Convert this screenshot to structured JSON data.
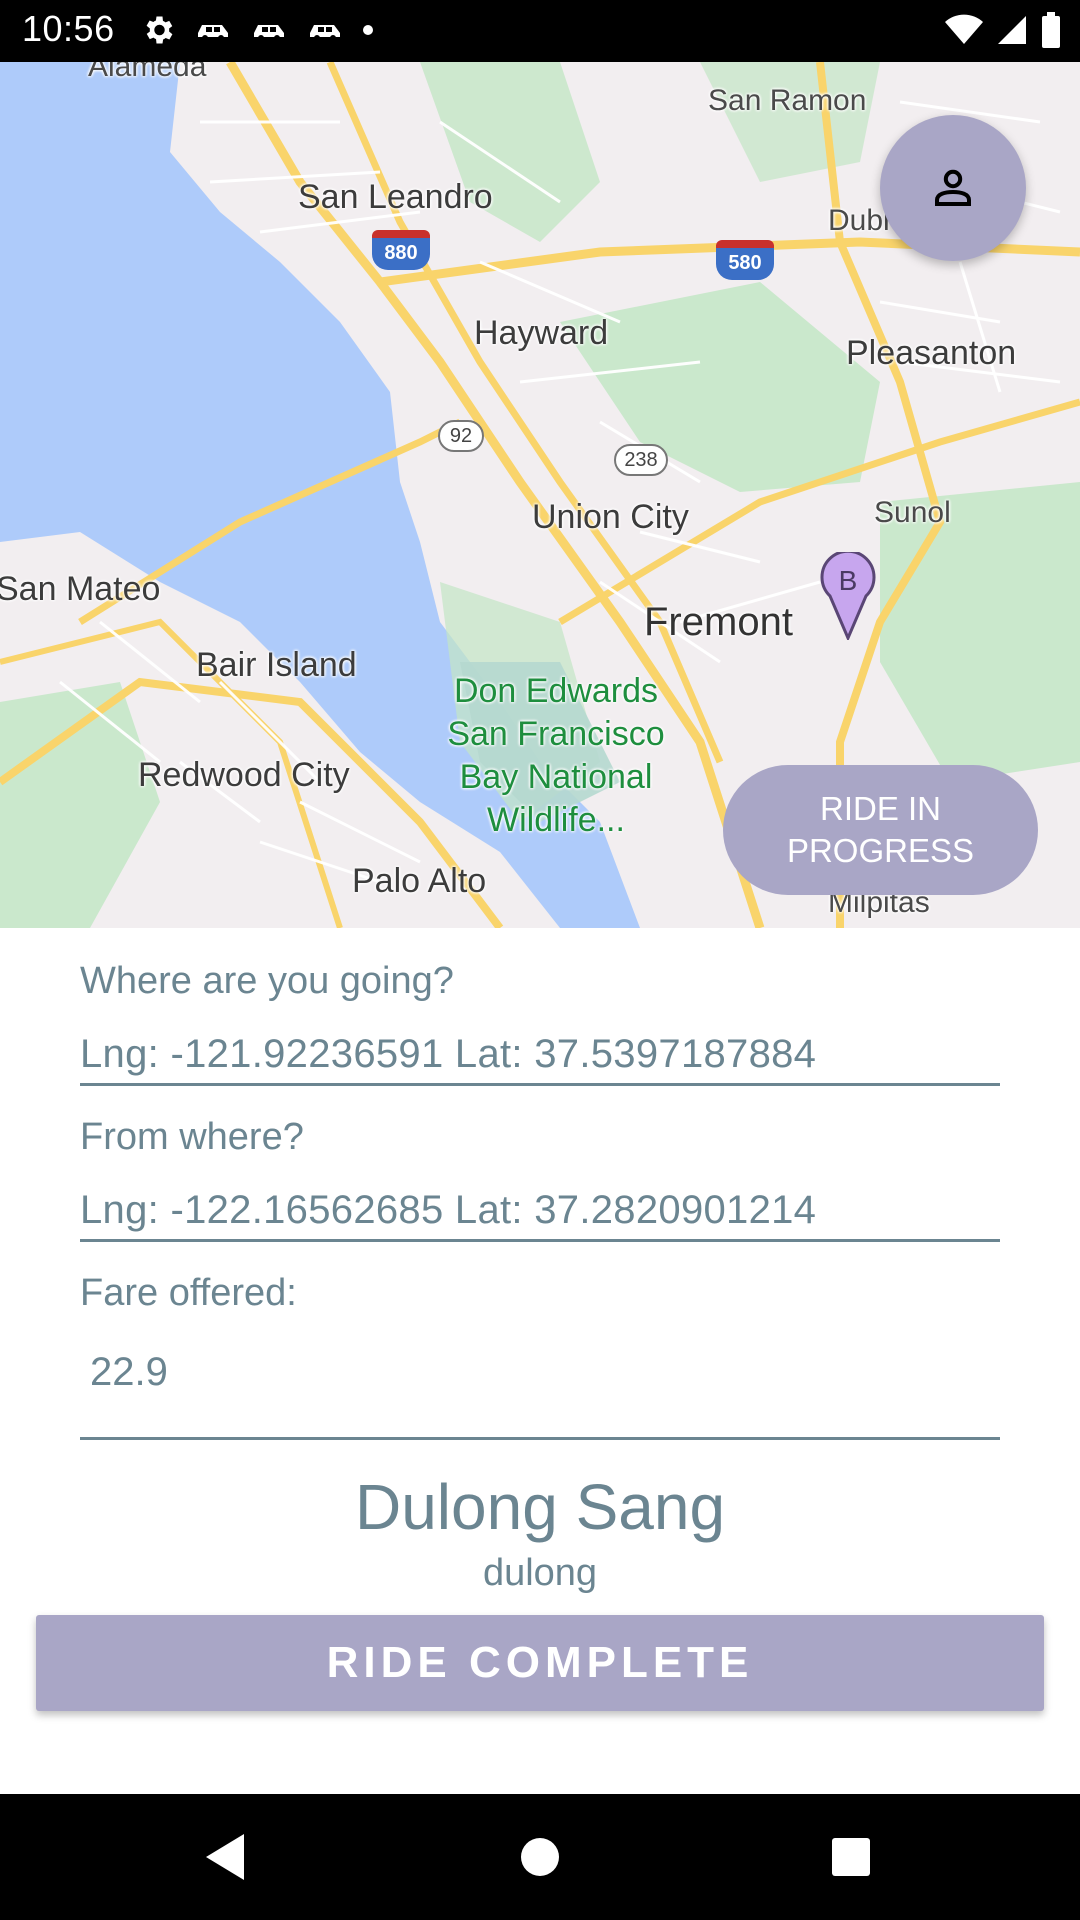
{
  "status_bar": {
    "time": "10:56",
    "left_icons": [
      "gear-icon",
      "car-icon",
      "car-icon",
      "car-icon",
      "dot-icon"
    ],
    "right_icons": [
      "wifi-icon",
      "signal-icon",
      "battery-icon"
    ]
  },
  "map": {
    "labels": {
      "alameda": "Alameda",
      "san_ramon": "San Ramon",
      "san_leandro": "San Leandro",
      "dublin": "Dubl",
      "hayward": "Hayward",
      "pleasanton": "Pleasanton",
      "union_city": "Union City",
      "sunol": "Sunol",
      "san_mateo": "San Mateo",
      "fremont": "Fremont",
      "bair_island": "Bair Island",
      "refuge_line1": "Don Edwards",
      "refuge_line2": "San Francisco",
      "refuge_line3": "Bay National",
      "refuge_line4": "Wildlife...",
      "redwood_city": "Redwood City",
      "palo_alto": "Palo Alto",
      "milpitas": "Milpitas"
    },
    "shields": {
      "i880": "880",
      "i580": "580",
      "r92": "92",
      "r238": "238"
    },
    "marker_letter": "B"
  },
  "profile_button": {
    "icon": "person-icon"
  },
  "ride_status": {
    "label": "RIDE IN PROGRESS"
  },
  "form": {
    "destination_label": "Where are you going?",
    "destination_value": "Lng: -121.92236591 Lat: 37.5397187884",
    "origin_label": "From where?",
    "origin_value": "Lng: -122.16562685 Lat: 37.2820901214",
    "fare_label": "Fare offered:",
    "fare_value": "22.9"
  },
  "driver": {
    "name": "Dulong Sang",
    "username": "dulong"
  },
  "action_button": {
    "label": "RIDE COMPLETE"
  },
  "nav_bar": {
    "buttons": [
      "back-icon",
      "home-icon",
      "recents-icon"
    ]
  },
  "colors": {
    "accent": "#a9a6c6",
    "text": "#6b8591",
    "water": "#aecbfa",
    "land": "#f2eef0",
    "park": "#c3e6c5",
    "road": "#f9d46b"
  }
}
